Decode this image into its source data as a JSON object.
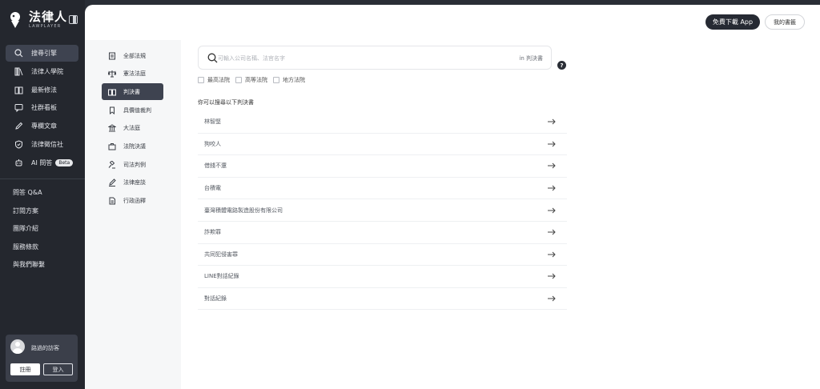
{
  "brand": {
    "name_cn": "法律人",
    "name_en": "LAWPLAYER"
  },
  "sidebar": {
    "nav": [
      {
        "label": "搜尋引擎",
        "icon": "search-icon",
        "active": true
      },
      {
        "label": "法律人學院",
        "icon": "books-icon"
      },
      {
        "label": "最新修法",
        "icon": "book-open-icon"
      },
      {
        "label": "社群看板",
        "icon": "chat-icon"
      },
      {
        "label": "專欄文章",
        "icon": "pen-icon"
      },
      {
        "label": "法律徵信社",
        "icon": "shield-icon"
      },
      {
        "label": "AI 問答",
        "icon": "robot-icon",
        "badge": "Beta"
      }
    ],
    "links": [
      "問答 Q&A",
      "訂閱方案",
      "團隊介紹",
      "服務條款",
      "與我們聯繫"
    ],
    "user": {
      "name": "路過的訪客",
      "signup": "註冊",
      "login": "登入"
    }
  },
  "header": {
    "download_app": "免費下載 App",
    "my_bookshelf": "我的書籤"
  },
  "subnav": [
    {
      "label": "全部法規",
      "icon": "document-icon"
    },
    {
      "label": "憲法法庭",
      "icon": "scale-icon"
    },
    {
      "label": "判決書",
      "icon": "book-open-icon",
      "active": true
    },
    {
      "label": "具價值裁判",
      "icon": "bookmark-icon"
    },
    {
      "label": "大法庭",
      "icon": "courthouse-icon"
    },
    {
      "label": "法院決議",
      "icon": "briefcase-icon"
    },
    {
      "label": "司法判例",
      "icon": "gavel-icon"
    },
    {
      "label": "法律座談",
      "icon": "edit-icon"
    },
    {
      "label": "行政函釋",
      "icon": "file-icon"
    }
  ],
  "search": {
    "placeholder": "可輸入公司名稱、法官名字",
    "value": "",
    "scope": "in 判決書"
  },
  "filters": [
    "最高法院",
    "高等法院",
    "地方法院"
  ],
  "results_title": "你可以搜尋以下判決書",
  "results": [
    "林智堅",
    "狗咬人",
    "借錢不還",
    "台積電",
    "臺灣積體電路製造股份有限公司",
    "詐欺罪",
    "共同犯侵害罪",
    "LINE對話紀錄",
    "對話紀錄"
  ],
  "colors": {
    "sidebar_bg": "#24272e",
    "active_bg": "#3e4350",
    "main_bg": "#ffffff",
    "subnav_bg": "#f6f7f8"
  }
}
